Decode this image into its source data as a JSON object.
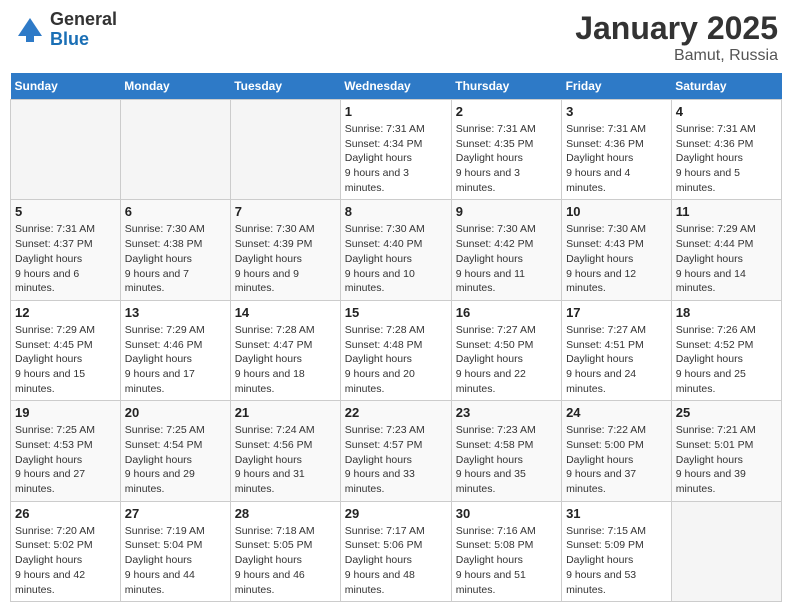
{
  "header": {
    "logo_general": "General",
    "logo_blue": "Blue",
    "month": "January 2025",
    "location": "Bamut, Russia"
  },
  "days_of_week": [
    "Sunday",
    "Monday",
    "Tuesday",
    "Wednesday",
    "Thursday",
    "Friday",
    "Saturday"
  ],
  "weeks": [
    [
      {
        "num": "",
        "empty": true
      },
      {
        "num": "",
        "empty": true
      },
      {
        "num": "",
        "empty": true
      },
      {
        "num": "1",
        "sunrise": "7:31 AM",
        "sunset": "4:34 PM",
        "daylight": "9 hours and 3 minutes."
      },
      {
        "num": "2",
        "sunrise": "7:31 AM",
        "sunset": "4:35 PM",
        "daylight": "9 hours and 3 minutes."
      },
      {
        "num": "3",
        "sunrise": "7:31 AM",
        "sunset": "4:36 PM",
        "daylight": "9 hours and 4 minutes."
      },
      {
        "num": "4",
        "sunrise": "7:31 AM",
        "sunset": "4:36 PM",
        "daylight": "9 hours and 5 minutes."
      }
    ],
    [
      {
        "num": "5",
        "sunrise": "7:31 AM",
        "sunset": "4:37 PM",
        "daylight": "9 hours and 6 minutes."
      },
      {
        "num": "6",
        "sunrise": "7:30 AM",
        "sunset": "4:38 PM",
        "daylight": "9 hours and 7 minutes."
      },
      {
        "num": "7",
        "sunrise": "7:30 AM",
        "sunset": "4:39 PM",
        "daylight": "9 hours and 9 minutes."
      },
      {
        "num": "8",
        "sunrise": "7:30 AM",
        "sunset": "4:40 PM",
        "daylight": "9 hours and 10 minutes."
      },
      {
        "num": "9",
        "sunrise": "7:30 AM",
        "sunset": "4:42 PM",
        "daylight": "9 hours and 11 minutes."
      },
      {
        "num": "10",
        "sunrise": "7:30 AM",
        "sunset": "4:43 PM",
        "daylight": "9 hours and 12 minutes."
      },
      {
        "num": "11",
        "sunrise": "7:29 AM",
        "sunset": "4:44 PM",
        "daylight": "9 hours and 14 minutes."
      }
    ],
    [
      {
        "num": "12",
        "sunrise": "7:29 AM",
        "sunset": "4:45 PM",
        "daylight": "9 hours and 15 minutes."
      },
      {
        "num": "13",
        "sunrise": "7:29 AM",
        "sunset": "4:46 PM",
        "daylight": "9 hours and 17 minutes."
      },
      {
        "num": "14",
        "sunrise": "7:28 AM",
        "sunset": "4:47 PM",
        "daylight": "9 hours and 18 minutes."
      },
      {
        "num": "15",
        "sunrise": "7:28 AM",
        "sunset": "4:48 PM",
        "daylight": "9 hours and 20 minutes."
      },
      {
        "num": "16",
        "sunrise": "7:27 AM",
        "sunset": "4:50 PM",
        "daylight": "9 hours and 22 minutes."
      },
      {
        "num": "17",
        "sunrise": "7:27 AM",
        "sunset": "4:51 PM",
        "daylight": "9 hours and 24 minutes."
      },
      {
        "num": "18",
        "sunrise": "7:26 AM",
        "sunset": "4:52 PM",
        "daylight": "9 hours and 25 minutes."
      }
    ],
    [
      {
        "num": "19",
        "sunrise": "7:25 AM",
        "sunset": "4:53 PM",
        "daylight": "9 hours and 27 minutes."
      },
      {
        "num": "20",
        "sunrise": "7:25 AM",
        "sunset": "4:54 PM",
        "daylight": "9 hours and 29 minutes."
      },
      {
        "num": "21",
        "sunrise": "7:24 AM",
        "sunset": "4:56 PM",
        "daylight": "9 hours and 31 minutes."
      },
      {
        "num": "22",
        "sunrise": "7:23 AM",
        "sunset": "4:57 PM",
        "daylight": "9 hours and 33 minutes."
      },
      {
        "num": "23",
        "sunrise": "7:23 AM",
        "sunset": "4:58 PM",
        "daylight": "9 hours and 35 minutes."
      },
      {
        "num": "24",
        "sunrise": "7:22 AM",
        "sunset": "5:00 PM",
        "daylight": "9 hours and 37 minutes."
      },
      {
        "num": "25",
        "sunrise": "7:21 AM",
        "sunset": "5:01 PM",
        "daylight": "9 hours and 39 minutes."
      }
    ],
    [
      {
        "num": "26",
        "sunrise": "7:20 AM",
        "sunset": "5:02 PM",
        "daylight": "9 hours and 42 minutes."
      },
      {
        "num": "27",
        "sunrise": "7:19 AM",
        "sunset": "5:04 PM",
        "daylight": "9 hours and 44 minutes."
      },
      {
        "num": "28",
        "sunrise": "7:18 AM",
        "sunset": "5:05 PM",
        "daylight": "9 hours and 46 minutes."
      },
      {
        "num": "29",
        "sunrise": "7:17 AM",
        "sunset": "5:06 PM",
        "daylight": "9 hours and 48 minutes."
      },
      {
        "num": "30",
        "sunrise": "7:16 AM",
        "sunset": "5:08 PM",
        "daylight": "9 hours and 51 minutes."
      },
      {
        "num": "31",
        "sunrise": "7:15 AM",
        "sunset": "5:09 PM",
        "daylight": "9 hours and 53 minutes."
      },
      {
        "num": "",
        "empty": true
      }
    ]
  ],
  "labels": {
    "sunrise": "Sunrise:",
    "sunset": "Sunset:",
    "daylight": "Daylight hours"
  }
}
